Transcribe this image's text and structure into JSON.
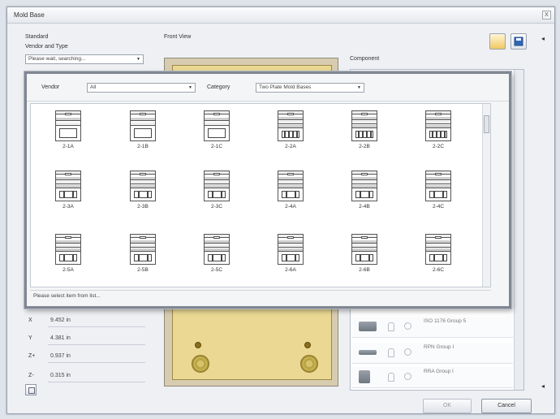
{
  "window": {
    "title": "Mold Base",
    "close_label": "X"
  },
  "left_panel": {
    "standard_label": "Standard",
    "vendor_type_label": "Vendor and Type",
    "vendor_combo_value": "Please wait, searching..."
  },
  "preview": {
    "label": "Front View"
  },
  "component": {
    "label": "Component",
    "rows": [
      {
        "text": "ISO 1176 Group 5",
        "icon": "bolt-icon"
      },
      {
        "text": "RPN Group I",
        "icon": "pin-icon"
      },
      {
        "text": "RRA Group I",
        "icon": "bushing-icon"
      }
    ]
  },
  "coords": [
    {
      "axis": "X",
      "value": "9.452 in"
    },
    {
      "axis": "Y",
      "value": "4.381 in"
    },
    {
      "axis": "Z+",
      "value": "0.937 in"
    },
    {
      "axis": "Z-",
      "value": "0.315 in"
    }
  ],
  "popup": {
    "vendor_label": "Vendor",
    "vendor_value": "All",
    "category_label": "Category",
    "category_value": "Two Plate Mold Bases",
    "status_text": "Please select item from list...",
    "items": [
      {
        "label": "2-1A",
        "style": "a"
      },
      {
        "label": "2-1B",
        "style": "a"
      },
      {
        "label": "2-1C",
        "style": "a"
      },
      {
        "label": "2-2A",
        "style": "b"
      },
      {
        "label": "2-2B",
        "style": "b"
      },
      {
        "label": "2-2C",
        "style": "b"
      },
      {
        "label": "2-3A",
        "style": "c"
      },
      {
        "label": "2-3B",
        "style": "c"
      },
      {
        "label": "2-3C",
        "style": "c"
      },
      {
        "label": "2-4A",
        "style": "c"
      },
      {
        "label": "2-4B",
        "style": "c"
      },
      {
        "label": "2-4C",
        "style": "c"
      },
      {
        "label": "2-5A",
        "style": "d"
      },
      {
        "label": "2-5B",
        "style": "d"
      },
      {
        "label": "2-5C",
        "style": "d"
      },
      {
        "label": "2-6A",
        "style": "d"
      },
      {
        "label": "2-6B",
        "style": "d"
      },
      {
        "label": "2-6C",
        "style": "d"
      }
    ]
  },
  "footer": {
    "ok_label": "OK",
    "cancel_label": "Cancel"
  },
  "colors": {
    "mold_plate": "#ead893",
    "popup_border": "#7f8792"
  }
}
